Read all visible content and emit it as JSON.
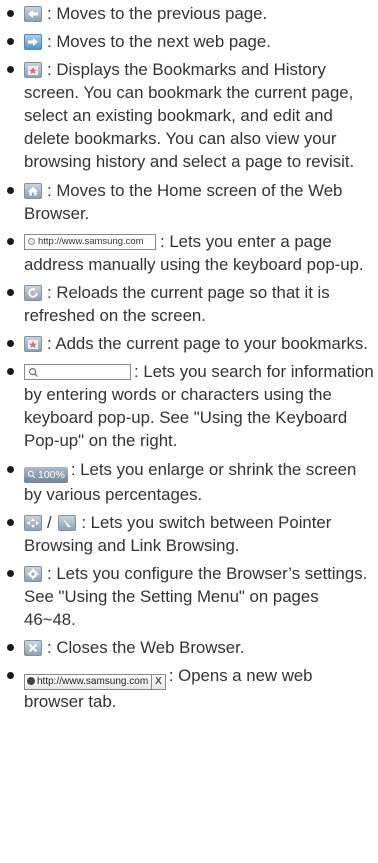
{
  "items": [
    {
      "icon": "back-arrow-icon",
      "text": ": Moves to the previous page."
    },
    {
      "icon": "forward-arrow-icon",
      "text": ": Moves to the next web page."
    },
    {
      "icon": "bookmark-star-icon",
      "text": ": Displays the Bookmarks and History screen. You can bookmark the current page, select an existing bookmark, and edit and delete bookmarks. You can also view your browsing history and select a page to revisit."
    },
    {
      "icon": "home-icon",
      "text": ": Moves to the Home screen of the Web Browser."
    },
    {
      "url_field": "http://www.samsung.com",
      "text": ": Lets you enter a page address manually using the keyboard pop-up."
    },
    {
      "icon": "reload-icon",
      "text": ": Reloads the current page so that it is refreshed on the screen."
    },
    {
      "icon": "add-bookmark-icon",
      "text": ": Adds the current page to your bookmarks."
    },
    {
      "search_glyph": "🔍",
      "text": ": Lets you search for information by entering words or characters using the keyboard pop-up. See \"Using the Keyboard Pop-up\" on the right."
    },
    {
      "zoom_label": "100%",
      "text": ": Lets you enlarge or shrink the screen by various percentages."
    },
    {
      "icon": "pointer-browsing-icon",
      "separator": "/",
      "icon2": "link-browsing-icon",
      "text": ": Lets you switch between Pointer Browsing and Link Browsing."
    },
    {
      "icon": "settings-gear-icon",
      "text": ": Lets you configure the Browser’s settings. See \"Using the Setting Menu\" on pages 46~48."
    },
    {
      "icon": "close-x-icon",
      "text": ": Closes the Web Browser."
    },
    {
      "tab_url": "http://www.samsung.com",
      "tab_close": "X",
      "text": ": Opens a new web browser tab."
    }
  ]
}
